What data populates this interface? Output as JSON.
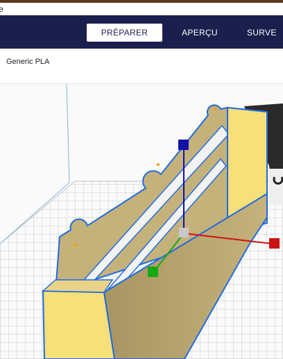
{
  "window": {
    "title_fragment": "e"
  },
  "stages": [
    {
      "label": "PRÉPARER",
      "active": true
    },
    {
      "label": "APERÇU",
      "active": false
    },
    {
      "label": "SURVE",
      "active": false
    }
  ],
  "toolbar": {
    "material": "Generic PLA"
  },
  "colors": {
    "header_bg": "#1a1f4d",
    "model_face": "#f7df7a",
    "model_side": "#b7a56f",
    "selection_outline": "#1e6be0",
    "axis_x": "#cc1111",
    "axis_y": "#11aa11",
    "axis_z": "#1111aa"
  },
  "icons": [
    "move-handle-x",
    "move-handle-y",
    "move-handle-z",
    "move-handle-center"
  ]
}
